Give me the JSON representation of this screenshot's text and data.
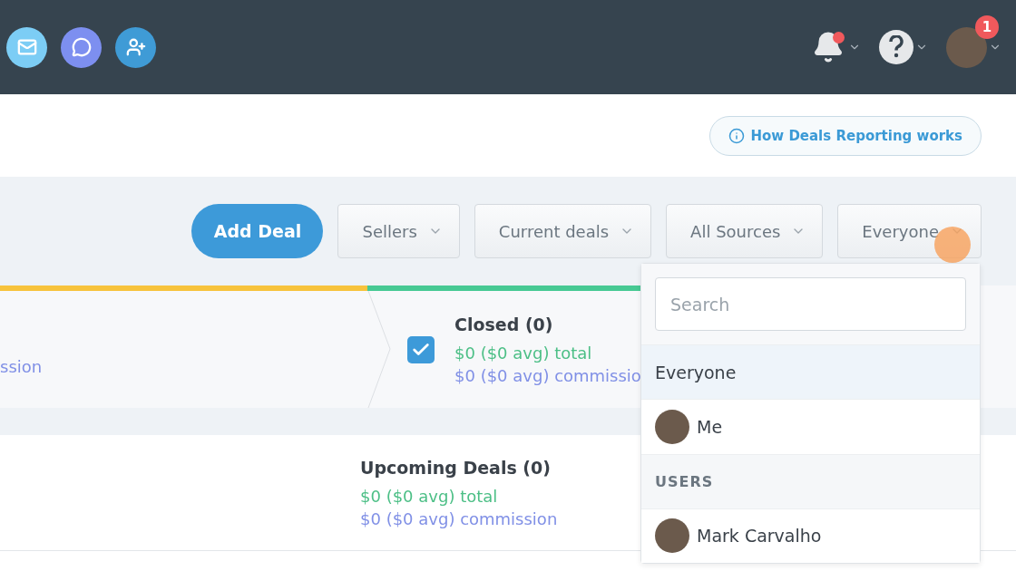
{
  "header": {
    "apps": [
      {
        "kind": "mail",
        "color": "#7ccdf5"
      },
      {
        "kind": "chat",
        "color": "#7d8ff0"
      },
      {
        "kind": "user",
        "color": "#3f9bd6"
      }
    ],
    "notifications": {
      "unread": true
    },
    "profile": {
      "badge": "1"
    }
  },
  "help_link": {
    "label": "How Deals Reporting works"
  },
  "toolbar": {
    "add_button": "Add Deal",
    "filters": [
      {
        "label": "Sellers"
      },
      {
        "label": "Current deals"
      },
      {
        "label": "All Sources"
      },
      {
        "label": "Everyone"
      }
    ]
  },
  "stages": [
    {
      "commission": "ssion",
      "color": "#f7c33c"
    },
    {
      "name": "Closed (0)",
      "total": "$0 ($0 avg) total",
      "commission": "$0 ($0 avg) commissio",
      "color": "#46c993",
      "checked": true
    }
  ],
  "upcoming": {
    "title": "Upcoming Deals (0)",
    "total": "$0 ($0 avg) total",
    "commission": "$0 ($0 avg) commission"
  },
  "dropdown": {
    "search_placeholder": "Search",
    "items": [
      {
        "kind": "option",
        "label": "Everyone",
        "selected": true
      },
      {
        "kind": "person",
        "label": "Me",
        "selected": false
      },
      {
        "kind": "section",
        "label": "USERS"
      },
      {
        "kind": "person",
        "label": "Mark Carvalho",
        "selected": false
      }
    ]
  }
}
